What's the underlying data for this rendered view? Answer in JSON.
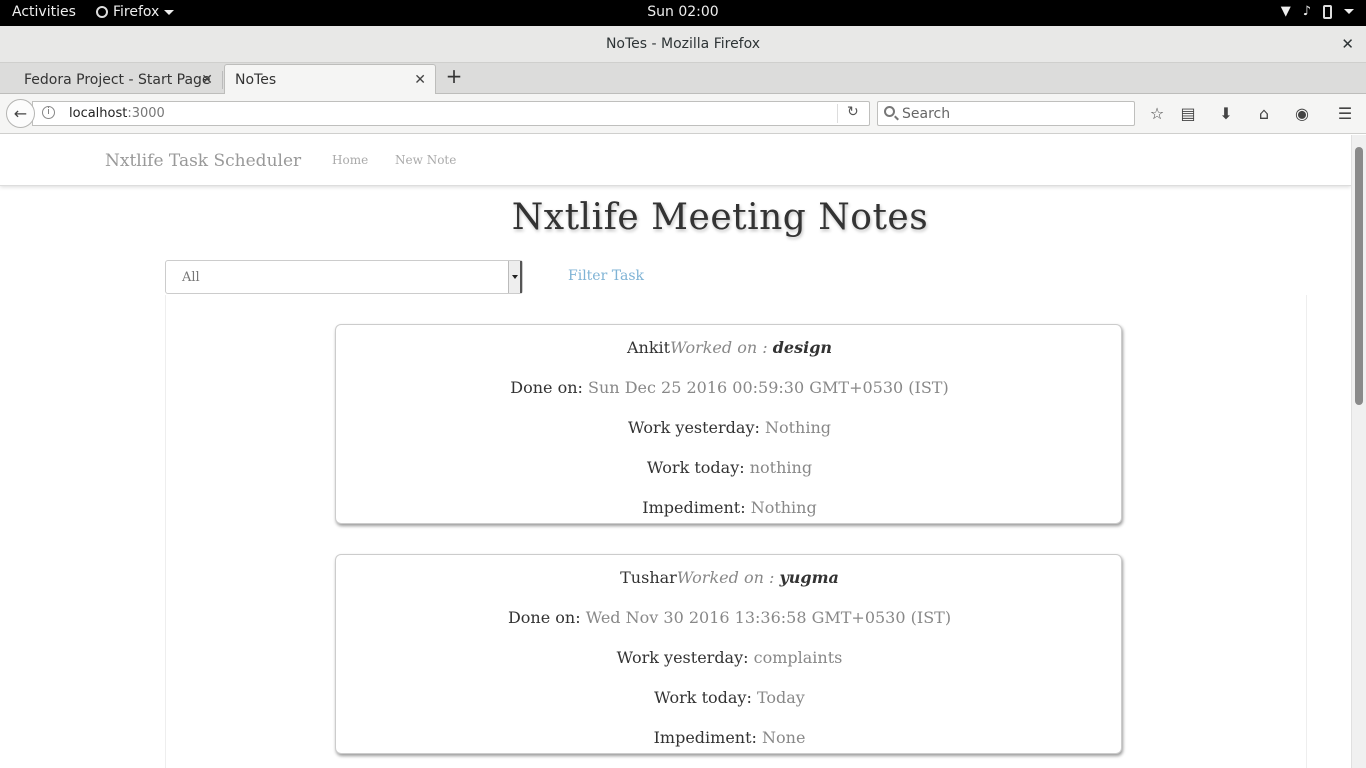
{
  "os_topbar": {
    "activities": "Activities",
    "app_name": "Firefox",
    "clock": "Sun 02:00"
  },
  "window": {
    "title": "NoTes - Mozilla Firefox"
  },
  "tabs": [
    {
      "label": "Fedora Project - Start Page"
    },
    {
      "label": "NoTes"
    }
  ],
  "navbar": {
    "url_host": "localhost",
    "url_port": ":3000",
    "search_placeholder": "Search"
  },
  "site": {
    "brand": "Nxtlife Task Scheduler",
    "nav": [
      "Home",
      "New Note"
    ],
    "heading": "Nxtlife Meeting Notes",
    "filter": {
      "selected": "All",
      "button": "Filter Task"
    },
    "labels": {
      "worked_on": "Worked on : ",
      "done_on": "Done on:",
      "work_yesterday": "Work yesterday:",
      "work_today": "Work today:",
      "impediment": "Impediment:"
    },
    "notes": [
      {
        "name": "Ankit",
        "task": "design",
        "done_on": "Sun Dec 25 2016 00:59:30 GMT+0530 (IST)",
        "work_yesterday": "Nothing",
        "work_today": "nothing",
        "impediment": "Nothing"
      },
      {
        "name": "Tushar",
        "task": "yugma",
        "done_on": "Wed Nov 30 2016 13:36:58 GMT+0530 (IST)",
        "work_yesterday": "complaints",
        "work_today": "Today",
        "impediment": "None"
      }
    ]
  }
}
